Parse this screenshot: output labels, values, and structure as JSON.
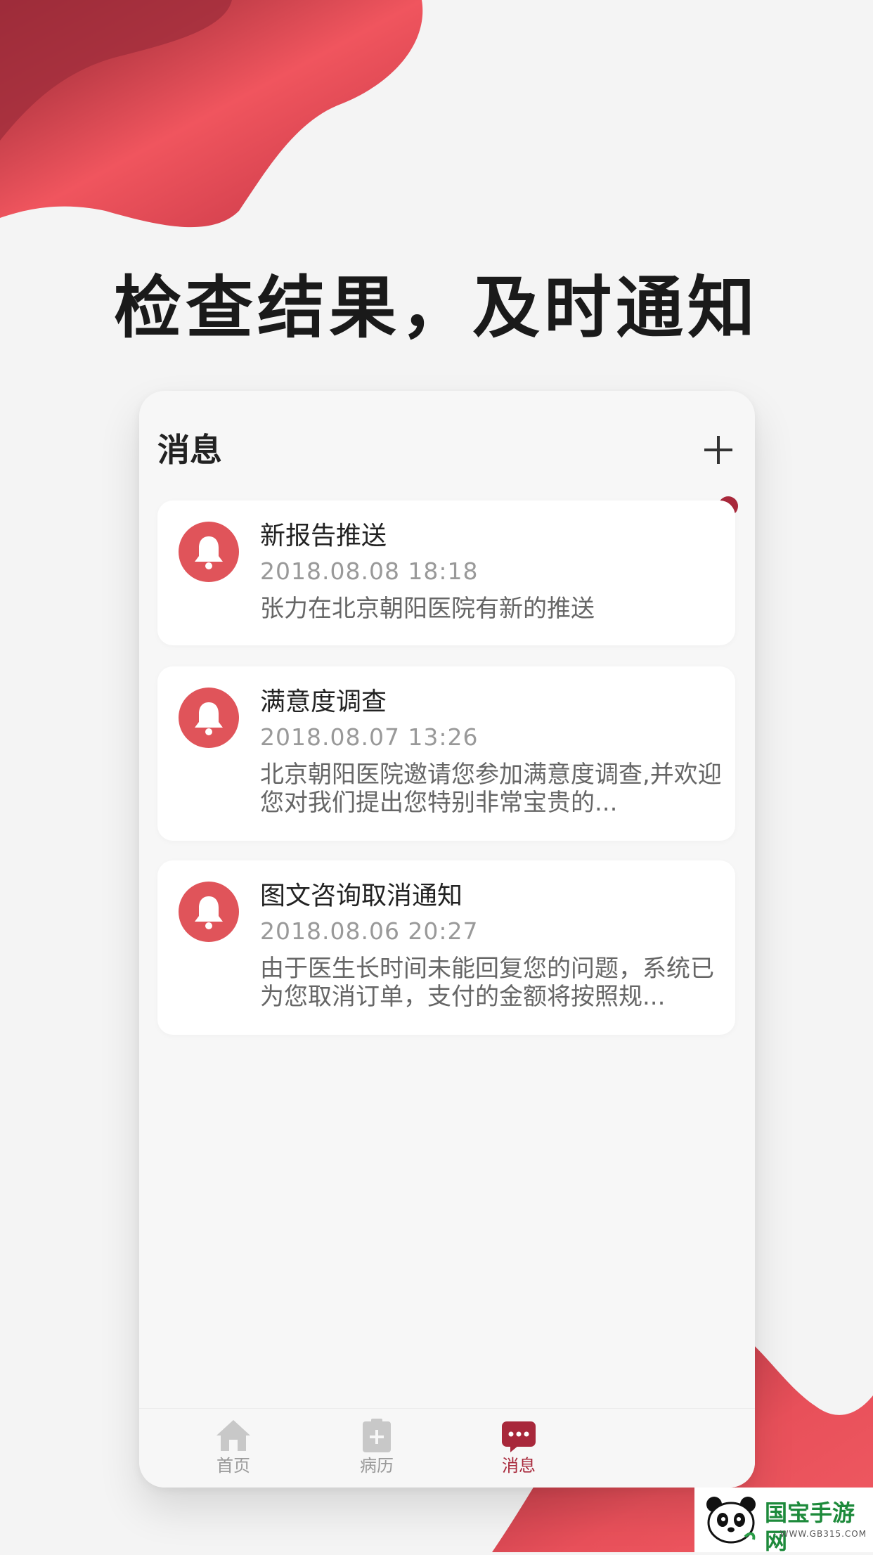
{
  "headline": "检查结果，及时通知",
  "screen": {
    "title": "消息"
  },
  "messages": [
    {
      "title": "新报告推送",
      "time": "2018.08.08  18:18",
      "body": "张力在北京朝阳医院有新的推送"
    },
    {
      "title": "满意度调查",
      "time": "2018.08.07  13:26",
      "body": "北京朝阳医院邀请您参加满意度调查,并欢迎您对我们提出您特别非常宝贵的..."
    },
    {
      "title": "图文咨询取消通知",
      "time": "2018.08.06  20:27",
      "body": "由于医生长时间未能回复您的问题，系统已为您取消订单，支付的金额将按照规..."
    }
  ],
  "tabs": [
    {
      "label": "首页",
      "icon": "home-icon",
      "active": false
    },
    {
      "label": "病历",
      "icon": "medical-record-icon",
      "active": false
    },
    {
      "label": "消息",
      "icon": "message-icon",
      "active": true
    }
  ],
  "watermark": {
    "text": "国宝手游网",
    "sub": "· WWW.GB315.COM ·"
  },
  "colors": {
    "accent": "#a8283b",
    "bell": "#e0545a",
    "blob": "#e04a55"
  }
}
